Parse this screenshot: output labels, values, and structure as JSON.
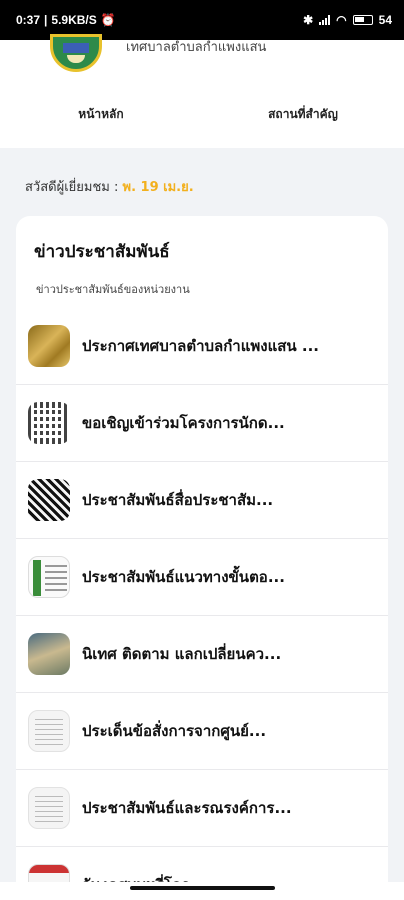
{
  "status_bar": {
    "time": "0:37",
    "net_speed": "5.9KB/S",
    "battery": "54"
  },
  "header": {
    "org_name": "เทศบาลตำบลกำแพงแสน",
    "nav": [
      {
        "label": "หน้าหลัก"
      },
      {
        "label": "สถานที่สำคัญ"
      }
    ]
  },
  "greeting": {
    "text": "สวัสดีผู้เยี่ยมชม : ",
    "date": "พ. 19 เม.ย."
  },
  "news": {
    "title": "ข่าวประชาสัมพันธ์",
    "subtitle": "ข่าวประชาสัมพันธ์ของหน่วยงาน",
    "items": [
      {
        "title": "ประกาศเทศบาลตำบลกำแพงแสน ...",
        "thumb": "gold-announcement"
      },
      {
        "title": "ขอเชิญเข้าร่วมโครงการนักด...",
        "thumb": "qr-code"
      },
      {
        "title": "ประชาสัมพันธ์สื่อประชาสัม...",
        "thumb": "qr-code"
      },
      {
        "title": "ประชาสัมพันธ์แนวทางขั้นตอ...",
        "thumb": "document"
      },
      {
        "title": "นิเทศ ติดตาม แลกเปลี่ยนคว...",
        "thumb": "photo"
      },
      {
        "title": "ประเด็นข้อสั่งการจากศูนย์...",
        "thumb": "paper"
      },
      {
        "title": "ประชาสัมพันธ์และรณรงค์การ...",
        "thumb": "paper"
      },
      {
        "title": "วันงดสูบบุหรี่โลก",
        "thumb": "poster"
      }
    ]
  }
}
